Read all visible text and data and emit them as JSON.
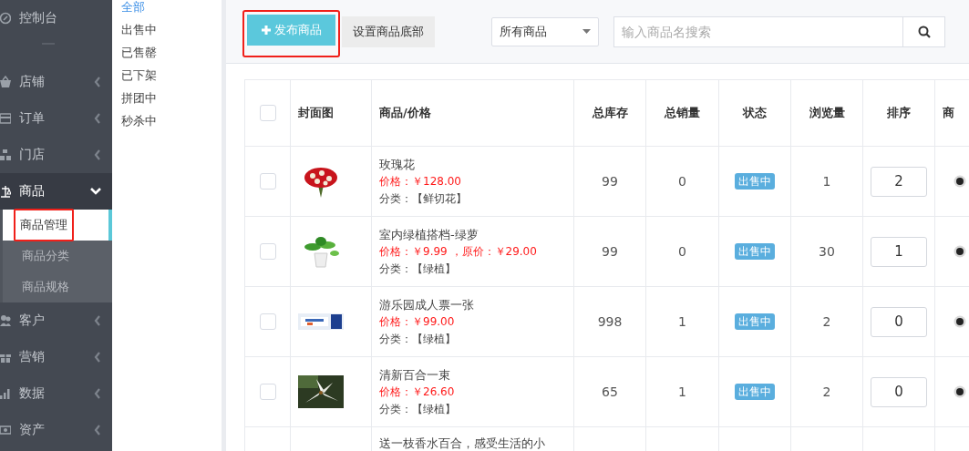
{
  "sidebar": {
    "items": [
      {
        "label": "控制台",
        "selected": false
      },
      {
        "label": "店铺",
        "selected": false,
        "expanded": false
      },
      {
        "label": "订单",
        "selected": false,
        "expanded": false
      },
      {
        "label": "门店",
        "selected": false,
        "expanded": false
      },
      {
        "label": "商品",
        "selected": true,
        "expanded": true,
        "children": [
          {
            "label": "商品管理",
            "selected": true,
            "highlighted": true
          },
          {
            "label": "商品分类",
            "selected": false,
            "highlighted": false
          },
          {
            "label": "商品规格",
            "selected": false,
            "highlighted": false
          }
        ]
      },
      {
        "label": "客户",
        "selected": false,
        "expanded": false
      },
      {
        "label": "营销",
        "selected": false,
        "expanded": false
      },
      {
        "label": "数据",
        "selected": false,
        "expanded": false
      },
      {
        "label": "资产",
        "selected": false,
        "expanded": false
      }
    ]
  },
  "filter_nav": [
    {
      "label": "全部",
      "selected": true
    },
    {
      "label": "出售中",
      "selected": false
    },
    {
      "label": "已售罄",
      "selected": false
    },
    {
      "label": "已下架",
      "selected": false
    },
    {
      "label": "拼团中",
      "selected": false
    },
    {
      "label": "秒杀中",
      "selected": false
    }
  ],
  "toolbar": {
    "publish_button": {
      "label": "发布商品",
      "highlighted": true
    },
    "footer_button": "设置商品底部",
    "type_select": "所有商品",
    "search": {
      "placeholder": "输入商品名搜索"
    }
  },
  "table": {
    "select_all_checked": false,
    "columns": [
      "封面图",
      "商品/价格",
      "总库存",
      "总销量",
      "状态",
      "浏览量",
      "排序",
      "商"
    ],
    "rows": [
      {
        "checked": false,
        "name": "玫瑰花",
        "price": "价格：￥128.00",
        "category": "分类：【鲜切花】",
        "stock": "99",
        "sales": "0",
        "status": "出售中",
        "views": "1",
        "sort": "2"
      },
      {
        "checked": false,
        "name": "室内绿植搭档-绿萝",
        "price": "价格：￥9.99 ，原价：￥29.00",
        "category": "分类：【绿植】",
        "stock": "99",
        "sales": "0",
        "status": "出售中",
        "views": "30",
        "sort": "1"
      },
      {
        "checked": false,
        "name": "游乐园成人票一张",
        "price": "价格：￥99.00",
        "category": "分类：【绿植】",
        "stock": "998",
        "sales": "1",
        "status": "出售中",
        "views": "2",
        "sort": "0"
      },
      {
        "checked": false,
        "name": "清新百合一束",
        "price": "价格：￥26.60",
        "category": "分类：【绿植】",
        "stock": "65",
        "sales": "1",
        "status": "出售中",
        "views": "2",
        "sort": "0"
      },
      {
        "name": "送一枝香水百合，感受生活的小"
      }
    ]
  }
}
